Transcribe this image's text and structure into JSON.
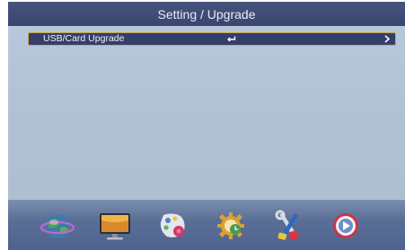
{
  "header": {
    "title": "Setting / Upgrade"
  },
  "menu": {
    "items": [
      {
        "label": "USB/Card Upgrade",
        "action_icon": "enter-icon",
        "nav_icon": "chevron-right-icon"
      }
    ]
  },
  "dock": {
    "icons": [
      "channel-icon",
      "picture-icon",
      "sound-icon",
      "time-icon",
      "setting-icon",
      "media-icon"
    ]
  },
  "colors": {
    "title_bar": "#3f4b75",
    "panel": "#b3c2d4",
    "selected_row": "#333f6a",
    "selection_border": "#c9a64a",
    "dock": "#5a6f96"
  }
}
